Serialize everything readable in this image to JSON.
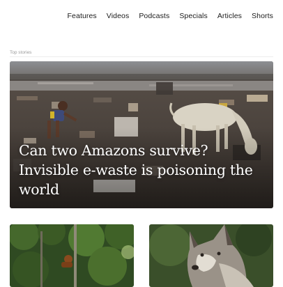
{
  "nav": {
    "items": [
      {
        "label": "Features"
      },
      {
        "label": "Videos"
      },
      {
        "label": "Podcasts"
      },
      {
        "label": "Specials"
      },
      {
        "label": "Articles"
      },
      {
        "label": "Shorts"
      }
    ]
  },
  "section": {
    "label": "Top stories"
  },
  "hero": {
    "title": "Can two Amazons survive? Invisible e-waste is poisoning the world"
  },
  "colors": {
    "nav_text": "#1a1a1a",
    "label_text": "#9a9a9a",
    "hero_text": "#ffffff"
  }
}
